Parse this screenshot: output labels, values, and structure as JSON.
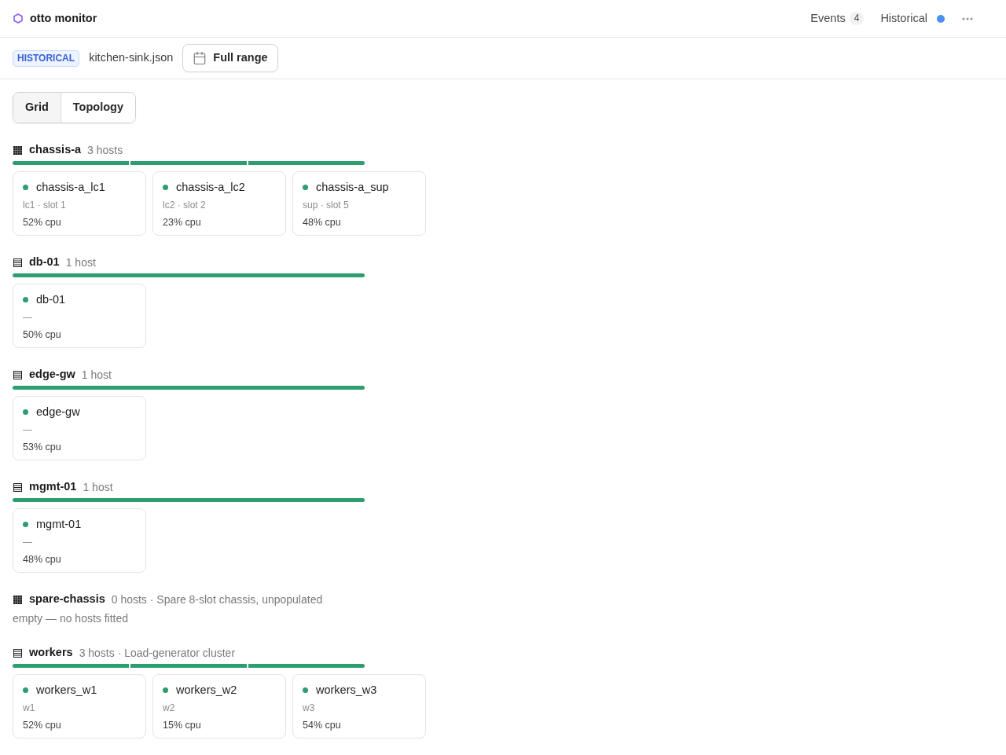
{
  "app": {
    "title": "otto monitor"
  },
  "header_nav": {
    "events": {
      "label": "Events",
      "count": "4"
    },
    "mode": {
      "label": "Historical"
    }
  },
  "toolbar": {
    "badge": "HISTORICAL",
    "file": "kitchen-sink.json",
    "range_button": "Full range"
  },
  "view_tabs": [
    {
      "label": "Grid",
      "selected": true
    },
    {
      "label": "Topology",
      "selected": false
    }
  ],
  "groups": [
    {
      "kind": "chassis",
      "name": "chassis-a",
      "summary": "3 hosts",
      "hosts": [
        {
          "name": "chassis-a_lc1",
          "color": "#2e9e6e",
          "detail": "lc1 · slot 1",
          "cpu": "52% cpu"
        },
        {
          "name": "chassis-a_lc2",
          "color": "#2e9e6e",
          "detail": "lc2 · slot 2",
          "cpu": "23% cpu"
        },
        {
          "name": "chassis-a_sup",
          "color": "#2e9e6e",
          "detail": "sup · slot 5",
          "cpu": "48% cpu"
        }
      ]
    },
    {
      "kind": "cluster",
      "name": "db-01",
      "summary": "1 host",
      "hosts": [
        {
          "name": "db-01",
          "color": "#2e9e6e",
          "detail": "—",
          "cpu": "50% cpu"
        }
      ]
    },
    {
      "kind": "cluster",
      "name": "edge-gw",
      "summary": "1 host",
      "hosts": [
        {
          "name": "edge-gw",
          "color": "#2e9e6e",
          "detail": "—",
          "cpu": "53% cpu"
        }
      ]
    },
    {
      "kind": "cluster",
      "name": "mgmt-01",
      "summary": "1 host",
      "hosts": [
        {
          "name": "mgmt-01",
          "color": "#2e9e6e",
          "detail": "—",
          "cpu": "48% cpu"
        }
      ]
    },
    {
      "kind": "chassis",
      "name": "spare-chassis",
      "summary": "0 hosts · Spare 8-slot chassis, unpopulated",
      "empty_note": "empty — no hosts fitted"
    },
    {
      "kind": "cluster",
      "name": "workers",
      "summary": "3 hosts · Load-generator cluster",
      "hosts": [
        {
          "name": "workers_w1",
          "color": "#2e9e6e",
          "detail": "w1",
          "cpu": "52% cpu"
        },
        {
          "name": "workers_w2",
          "color": "#2e9e6e",
          "detail": "w2",
          "cpu": "15% cpu"
        },
        {
          "name": "workers_w3",
          "color": "#2e9e6e",
          "detail": "w3",
          "cpu": "54% cpu"
        }
      ]
    }
  ]
}
